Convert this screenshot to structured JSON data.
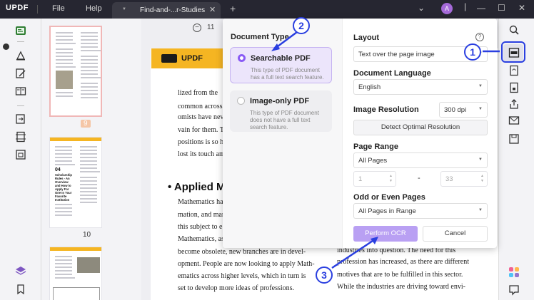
{
  "titlebar": {
    "logo": "UPDF",
    "menu": [
      "File",
      "Help"
    ],
    "tab_title": "Find-and-...r-Studies",
    "avatar_letter": "A"
  },
  "thumbnails": {
    "page_labels": [
      "9",
      "10"
    ],
    "thumb2_heading": "Scholarship Rules - An Overview and How to Apply For One In Your Favorite Institution",
    "thumb2_num": "04"
  },
  "document": {
    "zoom": "11",
    "banner": "UPDF",
    "lines_top": [
      "lized from the",
      "common across",
      "omists have nev",
      "vain for them. Th",
      "positions is so hi",
      "lost its touch am"
    ],
    "heading": "• Applied M",
    "lines_bottom": [
      "Mathematics has",
      "mation, and mam",
      "this subject to e",
      "Mathematics, as",
      "become obsolete, new branches are in devel-",
      "opment. People are now looking to apply Math-",
      "ematics across higher levels, which in turn is",
      "set to develop more ideas of professions."
    ],
    "right_lines": [
      "industries into question. The need for this",
      "profession has increased, as there are different",
      "motives that are to be fulfilled in this sector.",
      "While the industries are driving toward envi-"
    ]
  },
  "ocr_dialog": {
    "document_type_label": "Document Type",
    "options": [
      {
        "title": "Searchable PDF",
        "desc": "This type of PDF document has a full text search feature.",
        "selected": true
      },
      {
        "title": "Image-only PDF",
        "desc": "This type of PDF document does not have a full text search feature.",
        "selected": false
      }
    ],
    "layout_label": "Layout",
    "layout_value": "Text over the page image",
    "language_label": "Document Language",
    "language_value": "English",
    "resolution_label": "Image Resolution",
    "resolution_value": "300 dpi",
    "detect_button": "Detect Optimal Resolution",
    "page_range_label": "Page Range",
    "page_range_value": "All Pages",
    "range_from": "1",
    "range_dash": "-",
    "range_to": "33",
    "odd_even_label": "Odd or Even Pages",
    "odd_even_value": "All Pages in Range",
    "perform_button": "Perform OCR",
    "cancel_button": "Cancel",
    "help": "?"
  },
  "annotations": {
    "markers": [
      "1",
      "2",
      "3"
    ],
    "color": "#2a3fe0"
  },
  "colors": {
    "accent": "#8a5cf5",
    "brand_yellow": "#f5b522",
    "titlebar": "#262631"
  }
}
